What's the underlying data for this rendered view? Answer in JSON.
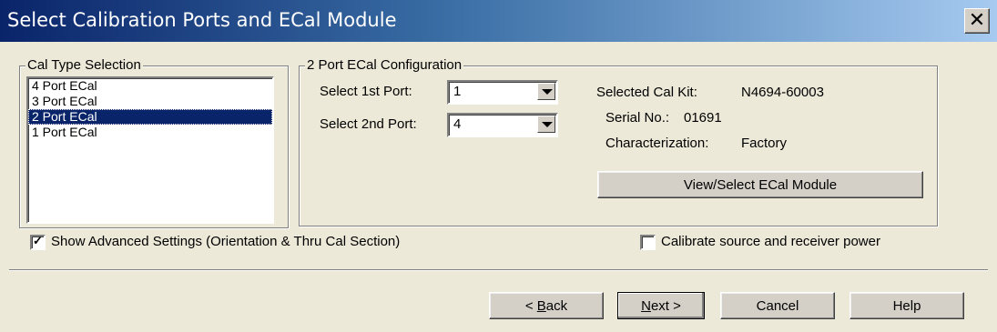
{
  "window": {
    "title": "Select Calibration Ports and ECal Module"
  },
  "cal_type": {
    "legend": "Cal Type Selection",
    "items": [
      "4 Port ECal",
      "3 Port ECal",
      "2 Port ECal",
      "1 Port ECal"
    ],
    "selected": "2 Port ECal"
  },
  "config": {
    "legend": "2 Port ECal Configuration",
    "port1_label": "Select 1st Port:",
    "port1_value": "1",
    "port2_label": "Select 2nd Port:",
    "port2_value": "4",
    "cal_kit_label": "Selected Cal Kit:",
    "cal_kit_value": "N4694-60003",
    "serial_label": "Serial No.:",
    "serial_value": "01691",
    "characterization_label": "Characterization:",
    "characterization_value": "Factory",
    "view_select_label": "View/Select ECal Module"
  },
  "options": {
    "advanced_label": "Show Advanced Settings (Orientation & Thru Cal Section)",
    "advanced_checked": true,
    "calibrate_power_label": "Calibrate source and receiver power",
    "calibrate_power_checked": false
  },
  "buttons": {
    "back_prefix": "< ",
    "back_access": "B",
    "back_rest": "ack",
    "next_access": "N",
    "next_rest": "ext >",
    "cancel": "Cancel",
    "help": "Help"
  },
  "icons": {
    "close": "close-icon",
    "dropdown": "chevron-down-icon",
    "check": "checkmark-icon"
  }
}
